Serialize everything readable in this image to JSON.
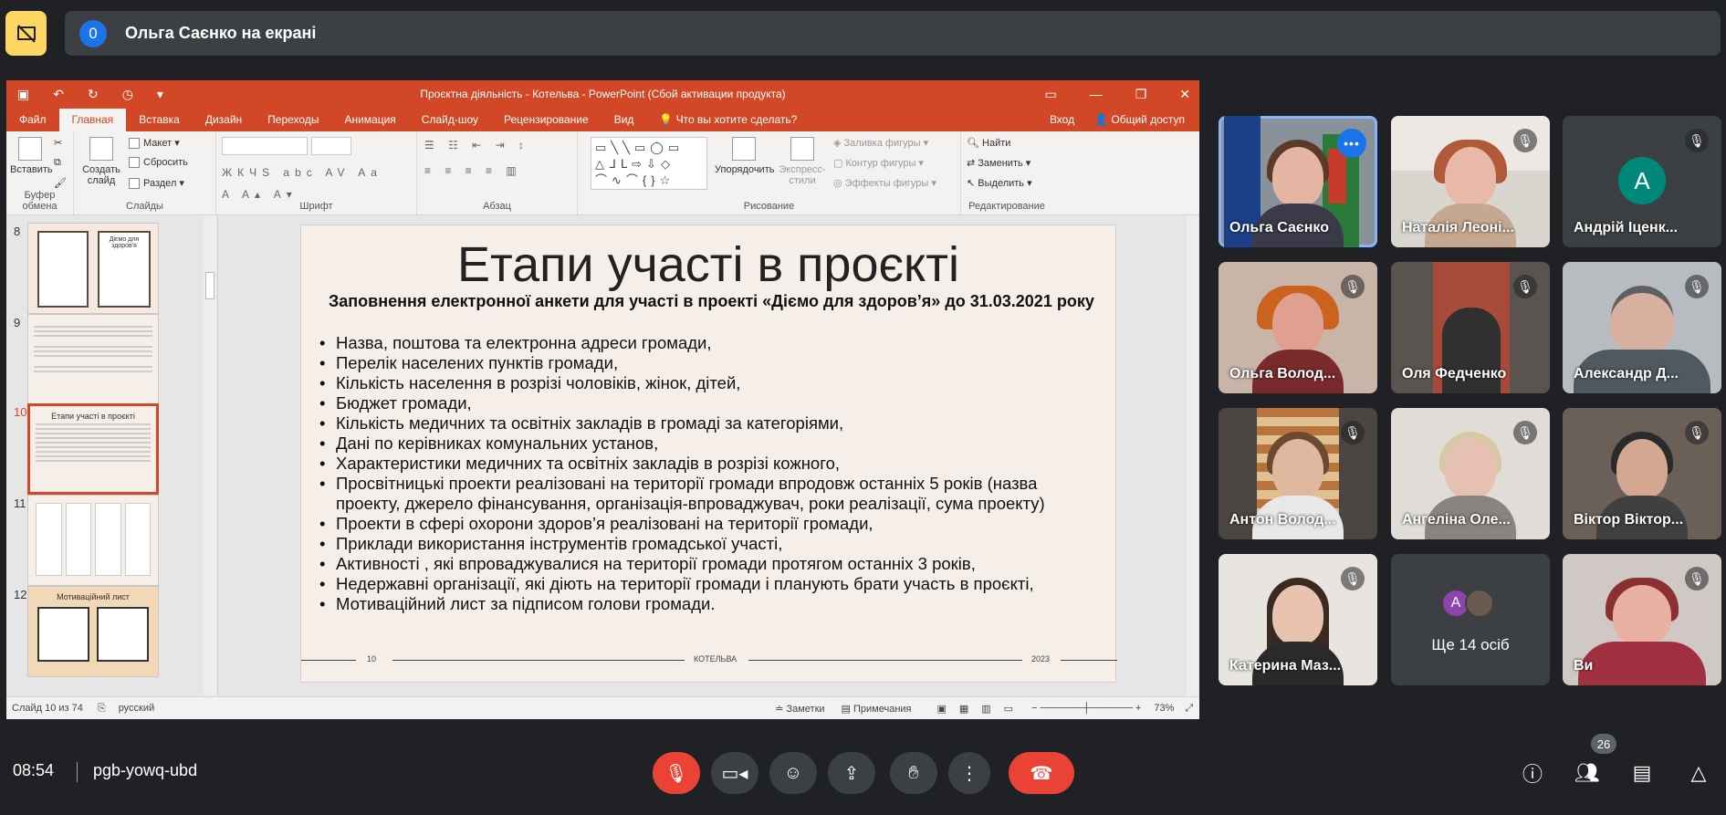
{
  "presenter_bar": {
    "count": "0",
    "text": "Ольга Саєнко на екрані"
  },
  "ppt": {
    "title": "Проєктна діяльність - Котельва - PowerPoint (Сбой активации продукта)",
    "tabs": [
      "Файл",
      "Главная",
      "Вставка",
      "Дизайн",
      "Переходы",
      "Анимация",
      "Слайд-шоу",
      "Рецензирование",
      "Вид",
      "Что вы хотите сделать?"
    ],
    "signin": "Вход",
    "share": "Общий доступ",
    "ribbon": {
      "paste": "Вставить",
      "create_slide": "Создать слайд",
      "layout": "Макет",
      "reset": "Сбросить",
      "section": "Раздел",
      "arrange": "Упорядочить",
      "quick_styles": "Экспресс-стили",
      "shape_fill": "Заливка фигуры",
      "shape_outline": "Контур фигуры",
      "shape_effects": "Эффекты фигуры",
      "find": "Найти",
      "replace": "Заменить",
      "select": "Выделить",
      "groups": [
        "Буфер обмена",
        "Слайды",
        "Шрифт",
        "Абзац",
        "Рисование",
        "Редактирование"
      ]
    },
    "thumbs": [
      {
        "num": "8",
        "title": "Діємо для здоров'я"
      },
      {
        "num": "9",
        "title": ""
      },
      {
        "num": "10",
        "title": "Етапи участі в проєкті"
      },
      {
        "num": "11",
        "title": ""
      },
      {
        "num": "12",
        "title": "Мотиваційний лист"
      }
    ],
    "slide": {
      "title": "Етапи участі в проєкті",
      "subtitle": "Заповнення електронної анкети для участі в проекті «Діємо для здоров’я» до 31.03.2021 року",
      "bullets": [
        "Назва, поштова та електронна адреси громади,",
        "Перелік населених пунктів громади,",
        "Кількість населення в розрізі чоловіків, жінок, дітей,",
        "Бюджет громади,",
        "Кількість медичних та освітніх закладів в громаді за категоріями,",
        "Дані по керівниках комунальних установ,",
        "Характеристики медичних та освітніх закладів в розрізі кожного,",
        "Просвітницькі проекти реалізовані на території громади впродовж останніх 5 років (назва проекту, джерело фінансування, організація-впроваджувач, роки реалізації, сума проекту)",
        "Проекти в сфері охорони здоров’я реалізовані на території громади,",
        "Приклади використання інструментів громадської участі,",
        "Активності , які впроваджувалися на території громади протягом останніх 3 років,",
        "Недержавні організації, які діють на території громади і планують брати участь в проєкті,",
        "Мотиваційний лист за підписом голови громади."
      ],
      "footer_num": "10",
      "footer_mid": "КОТЕЛЬВА",
      "footer_year": "2023"
    },
    "status": {
      "slide": "Слайд 10 из 74",
      "lang": "русский",
      "notes": "Заметки",
      "comments": "Примечания",
      "zoom": "73%"
    }
  },
  "participants": [
    {
      "name": "Ольга Саєнко",
      "type": "video",
      "active": true
    },
    {
      "name": "Наталія Леоні...",
      "type": "video",
      "muted": true
    },
    {
      "name": "Андрій Іценк...",
      "type": "avatar",
      "initial": "А",
      "muted": true
    },
    {
      "name": "Ольга Волод...",
      "type": "video",
      "muted": true
    },
    {
      "name": "Оля Федченко",
      "type": "video",
      "muted": true
    },
    {
      "name": "Александр Д...",
      "type": "video",
      "muted": true
    },
    {
      "name": "Антон Волод...",
      "type": "video",
      "muted": true
    },
    {
      "name": "Ангеліна Оле...",
      "type": "video",
      "muted": true
    },
    {
      "name": "Віктор Віктор...",
      "type": "video",
      "muted": true
    },
    {
      "name": "Катерина Маз...",
      "type": "video",
      "muted": true
    },
    {
      "name": "Ще 14 осіб",
      "type": "more",
      "initial": "А"
    },
    {
      "name": "Ви",
      "type": "video",
      "muted": true
    }
  ],
  "bottom": {
    "time": "08:54",
    "code": "pgb-yowq-ubd",
    "people_count": "26"
  },
  "colors": {
    "accent": "#1a73e8",
    "end_call": "#ea4335",
    "ppt_brand": "#d24726"
  }
}
